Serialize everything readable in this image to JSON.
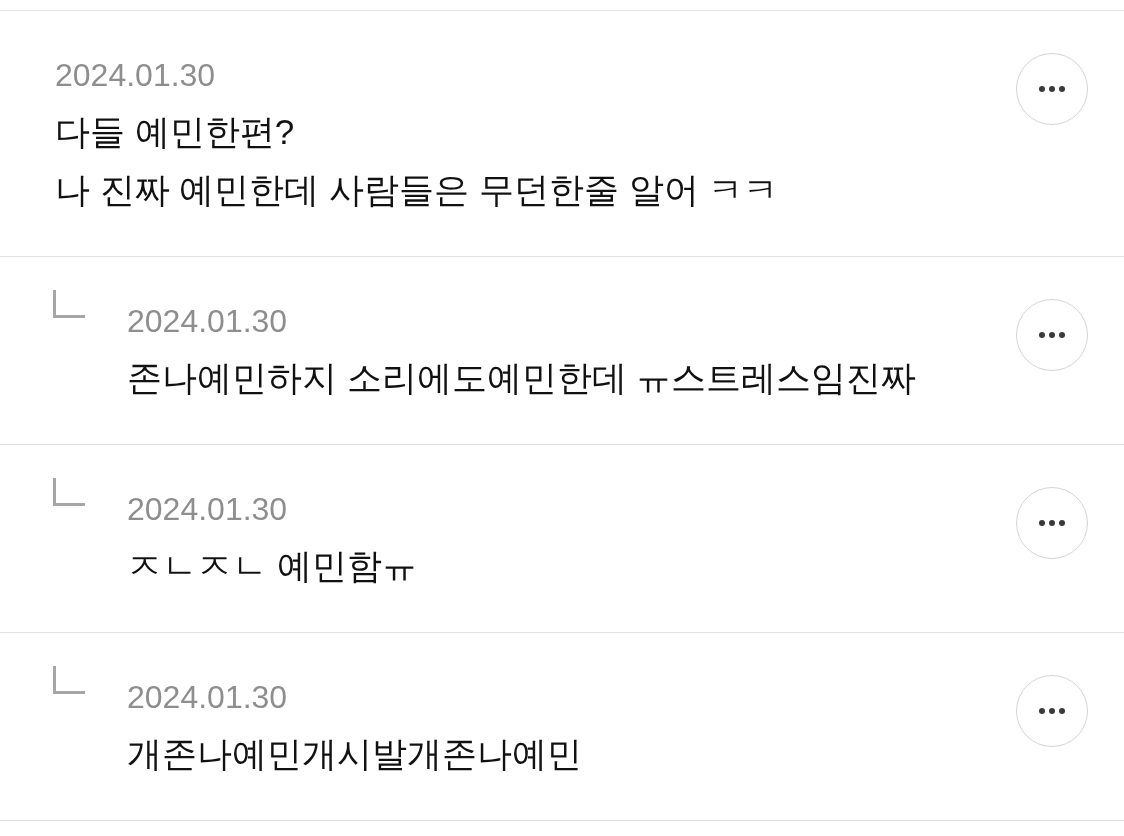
{
  "comments": [
    {
      "date": "2024.01.30",
      "text": "다들 예민한편?\n나 진짜 예민한데 사람들은 무던한줄 알어 ㅋㅋ",
      "replies": [
        {
          "date": "2024.01.30",
          "text": "존나예민하지 소리에도예민한데 ㅠ스트레스임진짜"
        },
        {
          "date": "2024.01.30",
          "text": "ㅈㄴㅈㄴ 예민함ㅠ"
        },
        {
          "date": "2024.01.30",
          "text": "개존나예민개시발개존나예민"
        }
      ]
    }
  ]
}
